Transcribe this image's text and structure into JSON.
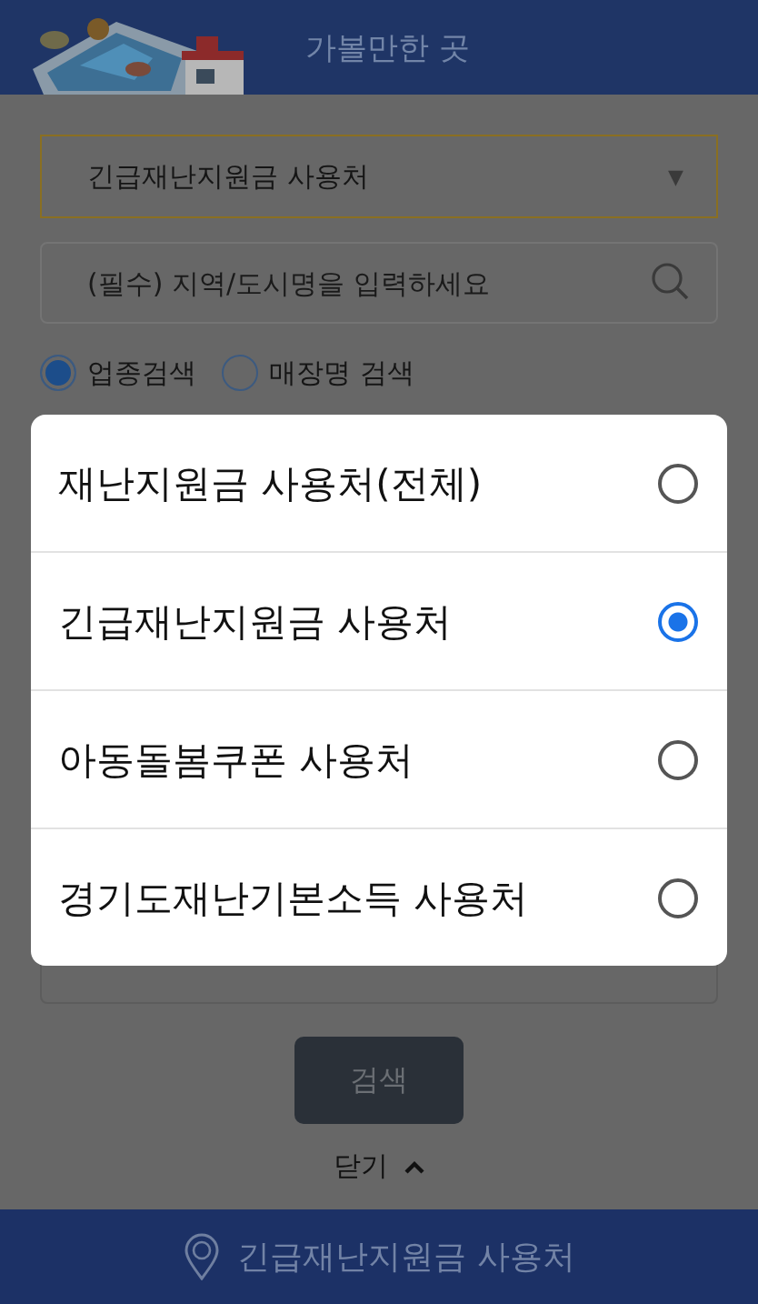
{
  "header": {
    "title": "가볼만한 곳"
  },
  "category_select": {
    "value": "긴급재난지원금 사용처",
    "arrow": "▼"
  },
  "search_field": {
    "placeholder": "(필수) 지역/도시명을 입력하세요"
  },
  "search_modes": [
    {
      "label": "업종검색",
      "selected": true
    },
    {
      "label": "매장명 검색",
      "selected": false
    }
  ],
  "search_button": "검색",
  "close_link": {
    "label": "닫기"
  },
  "dialog": {
    "options": [
      {
        "label": "재난지원금 사용처(전체)",
        "selected": false
      },
      {
        "label": "긴급재난지원금 사용처",
        "selected": true
      },
      {
        "label": "아동돌봄쿠폰 사용처",
        "selected": false
      },
      {
        "label": "경기도재난기본소득 사용처",
        "selected": false
      }
    ]
  },
  "footer": {
    "label": "긴급재난지원금 사용처"
  }
}
